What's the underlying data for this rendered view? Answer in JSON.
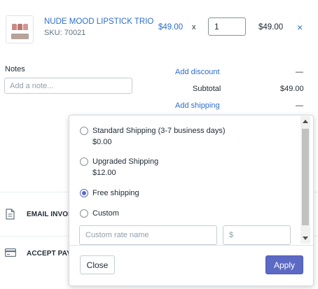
{
  "line_item": {
    "product_name": "NUDE MOOD LIPSTICK TRIO",
    "sku": "SKU: 70021",
    "unit_price": "$49.00",
    "times": "x",
    "quantity": "1",
    "line_total": "$49.00",
    "remove_glyph": "×",
    "thumbnail_icon": "lipstick-trio-icon",
    "lipstick_colors": [
      "#c98a86",
      "#b97772",
      "#cf9a92"
    ]
  },
  "notes": {
    "label": "Notes",
    "placeholder": "Add a note..."
  },
  "summary": {
    "add_discount": "Add discount",
    "discount_value": "—",
    "subtotal_label": "Subtotal",
    "subtotal_value": "$49.00",
    "add_shipping": "Add shipping",
    "shipping_value": "—"
  },
  "sections": {
    "email_invoice": "EMAIL INVOI",
    "email_icon": "document-icon",
    "accept_payment": "ACCEPT PAYM",
    "payment_icon": "credit-card-icon"
  },
  "shipping_popover": {
    "options": [
      {
        "label": "Standard Shipping (3-7 business days)",
        "price": "$0.00",
        "checked": false
      },
      {
        "label": "Upgraded Shipping",
        "price": "$12.00",
        "checked": false
      },
      {
        "label": "Free shipping",
        "price": "",
        "checked": true
      },
      {
        "label": "Custom",
        "price": "",
        "checked": false
      }
    ],
    "custom_name_placeholder": "Custom rate name",
    "custom_price_placeholder": "$",
    "close_label": "Close",
    "apply_label": "Apply"
  },
  "colors": {
    "link": "#2c6ecb",
    "primary": "#5c6ac4",
    "text": "#212b36"
  }
}
